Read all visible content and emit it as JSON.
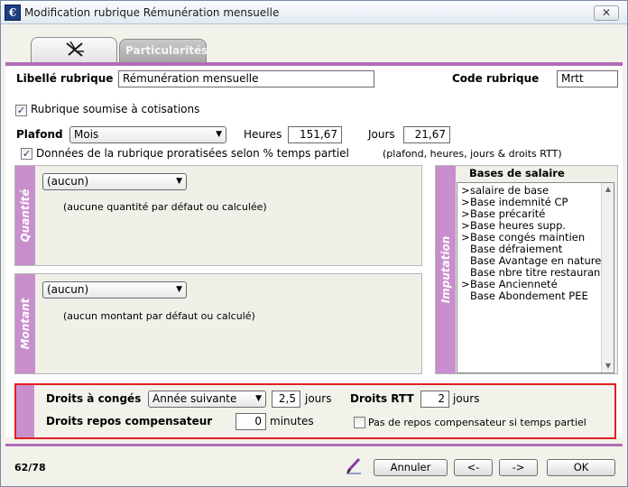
{
  "window": {
    "title": "Modification rubrique Rémunération mensuelle",
    "close": "✕"
  },
  "tabs": [
    {
      "label": ""
    },
    {
      "label": "Particularités"
    }
  ],
  "form": {
    "libelle_label": "Libellé rubrique",
    "libelle_value": "Rémunération mensuelle",
    "code_label": "Code rubrique",
    "code_value": "Mrtt",
    "cotisations_label": "Rubrique soumise à cotisations",
    "plafond_label": "Plafond",
    "plafond_value": "Mois",
    "heures_label": "Heures",
    "heures_value": "151,67",
    "jours_label": "Jours",
    "jours_value": "21,67",
    "prorata_label": "Données de la rubrique proratisées selon % temps partiel",
    "prorata_note": "(plafond, heures, jours & droits RTT)"
  },
  "quantite": {
    "tab_label": "Quantité",
    "select_value": "(aucun)",
    "note": "(aucune quantité par défaut ou calculée)"
  },
  "montant": {
    "tab_label": "Montant",
    "select_value": "(aucun)",
    "note": "(aucun montant par défaut ou calculé)"
  },
  "imputation": {
    "tab_label": "Imputation",
    "list_title": "Bases de salaire",
    "items": [
      {
        "mark": ">",
        "label": "salaire de base"
      },
      {
        "mark": ">",
        "label": "Base indemnité CP"
      },
      {
        "mark": ">",
        "label": "Base précarité"
      },
      {
        "mark": ">",
        "label": "Base heures supp."
      },
      {
        "mark": ">",
        "label": "Base congés maintien"
      },
      {
        "mark": "",
        "label": "Base défraiement"
      },
      {
        "mark": "",
        "label": "Base Avantage en nature"
      },
      {
        "mark": "",
        "label": "Base nbre titre restauran"
      },
      {
        "mark": ">",
        "label": "Base Ancienneté"
      },
      {
        "mark": "",
        "label": "Base Abondement PEE"
      }
    ]
  },
  "droits": {
    "conges_label": "Droits à congés",
    "conges_select": "Année suivante",
    "conges_value": "2,5",
    "conges_unit": "jours",
    "rtt_label": "Droits RTT",
    "rtt_value": "2",
    "rtt_unit": "jours",
    "repos_label": "Droits repos compensateur",
    "repos_value": "0",
    "repos_unit": "minutes",
    "repos_check_label": "Pas de repos compensateur si temps partiel"
  },
  "footer": {
    "counter": "62/78",
    "annuler": "Annuler",
    "prev": "<-",
    "next": "->",
    "ok": "OK"
  },
  "colors": {
    "accent_purple": "#b06bb8",
    "tab_purple": "#c88fcc",
    "highlight_red": "#e02020"
  }
}
